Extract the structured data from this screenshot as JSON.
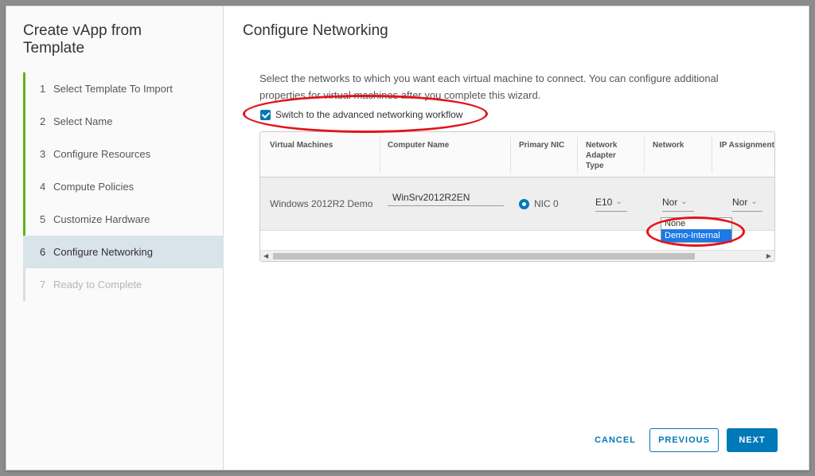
{
  "wizard": {
    "title": "Create vApp from Template",
    "steps": [
      {
        "num": "1",
        "label": "Select Template To Import",
        "state": "done"
      },
      {
        "num": "2",
        "label": "Select Name",
        "state": "done"
      },
      {
        "num": "3",
        "label": "Configure Resources",
        "state": "done"
      },
      {
        "num": "4",
        "label": "Compute Policies",
        "state": "done"
      },
      {
        "num": "5",
        "label": "Customize Hardware",
        "state": "done"
      },
      {
        "num": "6",
        "label": "Configure Networking",
        "state": "active"
      },
      {
        "num": "7",
        "label": "Ready to Complete",
        "state": "disabled"
      }
    ]
  },
  "main": {
    "title": "Configure Networking",
    "intro": "Select the networks to which you want each virtual machine to connect. You can configure additional properties for virtual machines after you complete this wizard.",
    "advanced_checkbox_label": "Switch to the advanced networking workflow",
    "advanced_checked": true
  },
  "grid": {
    "columns": [
      "Virtual Machines",
      "Computer Name",
      "Primary NIC",
      "Network Adapter Type",
      "Network",
      "IP Assignment"
    ],
    "rows": [
      {
        "vm": "Windows 2012R2 Demo",
        "computer_name": "WinSrv2012R2EN",
        "primary_nic": "NIC 0",
        "adapter_type": "E10",
        "network": "Nor",
        "ip_assignment": "Nor"
      }
    ],
    "network_dropdown_options": [
      "None",
      "Demo-Internal"
    ],
    "network_dropdown_selected": "Demo-Internal"
  },
  "footer": {
    "cancel": "CANCEL",
    "previous": "PREVIOUS",
    "next": "NEXT"
  },
  "colors": {
    "accent": "#0079b8",
    "step_done": "#60b515",
    "step_active_bg": "#d9e4ea",
    "annotation": "#e3131b",
    "dropdown_highlight": "#1e78e6"
  }
}
